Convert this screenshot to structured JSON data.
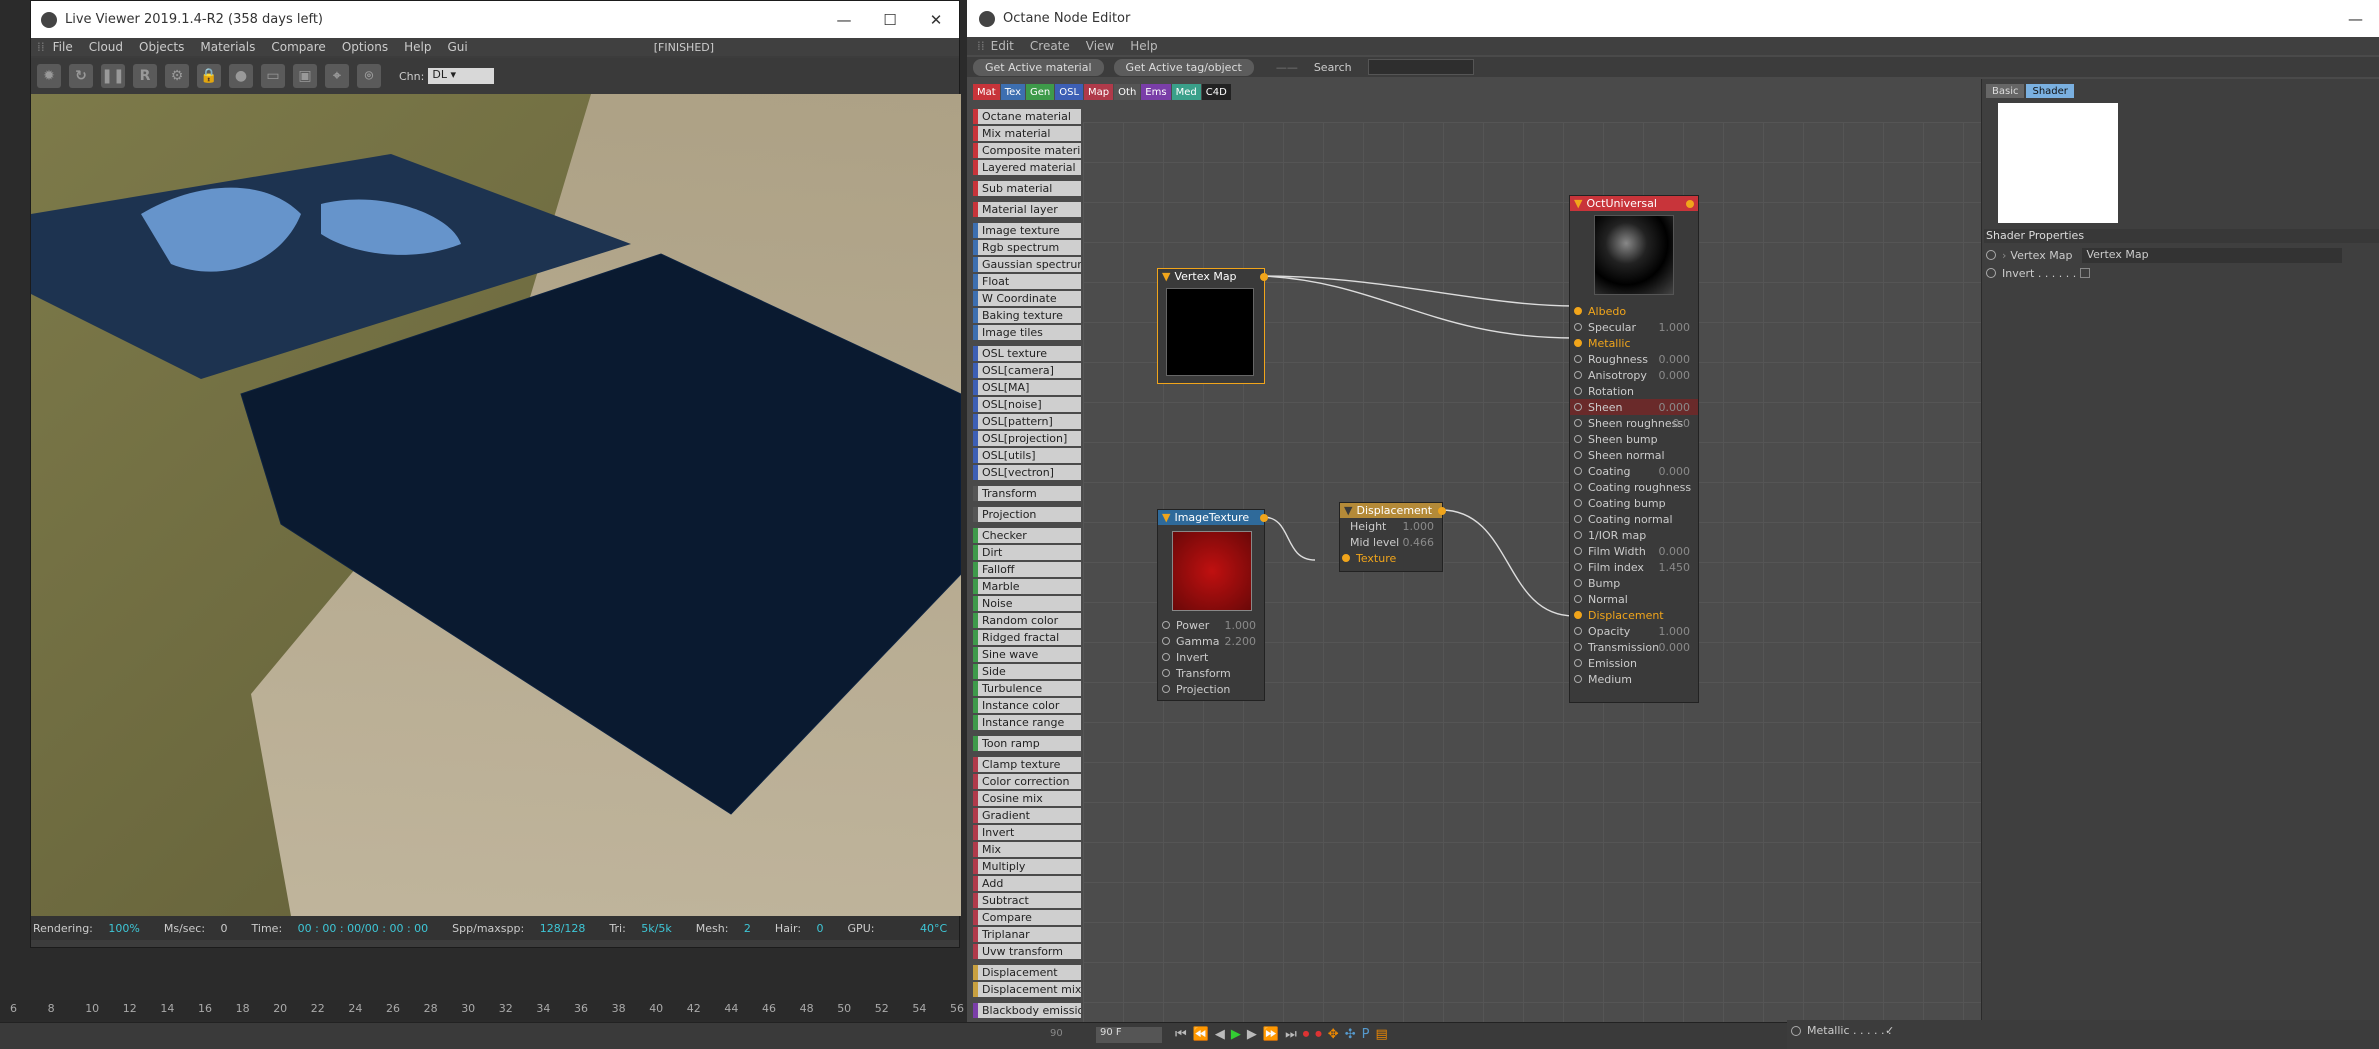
{
  "live_viewer": {
    "title": "Live Viewer 2019.1.4-R2 (358 days left)",
    "menu": [
      "File",
      "Cloud",
      "Objects",
      "Materials",
      "Compare",
      "Options",
      "Help",
      "Gui"
    ],
    "state": "[FINISHED]",
    "tool_icons": [
      "gear-icon",
      "refresh-icon",
      "pause-icon",
      "r-icon",
      "settings-icon",
      "lock-icon",
      "sphere-icon",
      "region-icon",
      "region2-icon",
      "pin-icon",
      "pin2-icon"
    ],
    "channel_label": "Chn:",
    "channel_value": "DL",
    "status": {
      "rendering_label": "Rendering:",
      "rendering": "100%",
      "ms_label": "Ms/sec:",
      "ms": "0",
      "time_label": "Time:",
      "time": "00 : 00 : 00/00 : 00 : 00",
      "spp_label": "Spp/maxspp:",
      "spp": "128/128",
      "tri_label": "Tri:",
      "tri": "5k/5k",
      "mesh_label": "Mesh:",
      "mesh": "2",
      "hair_label": "Hair:",
      "hair": "0",
      "gpu_label": "GPU:",
      "gpu": "40°C"
    }
  },
  "node_editor": {
    "title": "Octane Node Editor",
    "menu": [
      "Edit",
      "Create",
      "View",
      "Help"
    ],
    "get_active_material": "Get Active material",
    "get_active_tag": "Get Active tag/object",
    "search_label": "Search",
    "categories": [
      {
        "label": "Mat",
        "color": "#c8343a"
      },
      {
        "label": "Tex",
        "color": "#3d6fb0"
      },
      {
        "label": "Gen",
        "color": "#3e9a4a"
      },
      {
        "label": "OSL",
        "color": "#3d5fb5"
      },
      {
        "label": "Map",
        "color": "#b03a4a"
      },
      {
        "label": "Oth",
        "color": "#555"
      },
      {
        "label": "Ems",
        "color": "#7a3ea8"
      },
      {
        "label": "Med",
        "color": "#3aa08a"
      },
      {
        "label": "C4D",
        "color": "#222"
      }
    ],
    "node_list": [
      {
        "label": "Octane material",
        "color": "#c8343a"
      },
      {
        "label": "Mix material",
        "color": "#c8343a"
      },
      {
        "label": "Composite material",
        "color": "#c8343a"
      },
      {
        "label": "Layered material",
        "color": "#c8343a"
      },
      {
        "label": "Sub material",
        "color": "#c8343a",
        "gap": true
      },
      {
        "label": "Material layer",
        "color": "#c8343a",
        "gap": true
      },
      {
        "label": "Image texture",
        "color": "#3d6fb0",
        "gap": true
      },
      {
        "label": "Rgb spectrum",
        "color": "#3d6fb0"
      },
      {
        "label": "Gaussian spectrum",
        "color": "#3d6fb0"
      },
      {
        "label": "Float",
        "color": "#3d6fb0"
      },
      {
        "label": "W Coordinate",
        "color": "#3d6fb0"
      },
      {
        "label": "Baking texture",
        "color": "#3d6fb0"
      },
      {
        "label": "Image tiles",
        "color": "#3d6fb0"
      },
      {
        "label": "OSL texture",
        "color": "#3d5fb5",
        "gap": true
      },
      {
        "label": "OSL[camera]",
        "color": "#3d5fb5"
      },
      {
        "label": "OSL[MA]",
        "color": "#3d5fb5"
      },
      {
        "label": "OSL[noise]",
        "color": "#3d5fb5"
      },
      {
        "label": "OSL[pattern]",
        "color": "#3d5fb5"
      },
      {
        "label": "OSL[projection]",
        "color": "#3d5fb5"
      },
      {
        "label": "OSL[utils]",
        "color": "#3d5fb5"
      },
      {
        "label": "OSL[vectron]",
        "color": "#3d5fb5"
      },
      {
        "label": "Transform",
        "color": "#555",
        "gap": true
      },
      {
        "label": "Projection",
        "color": "#555",
        "gap": true
      },
      {
        "label": "Checker",
        "color": "#3e9a4a",
        "gap": true
      },
      {
        "label": "Dirt",
        "color": "#3e9a4a"
      },
      {
        "label": "Falloff",
        "color": "#3e9a4a"
      },
      {
        "label": "Marble",
        "color": "#3e9a4a"
      },
      {
        "label": "Noise",
        "color": "#3e9a4a"
      },
      {
        "label": "Random color",
        "color": "#3e9a4a"
      },
      {
        "label": "Ridged fractal",
        "color": "#3e9a4a"
      },
      {
        "label": "Sine wave",
        "color": "#3e9a4a"
      },
      {
        "label": "Side",
        "color": "#3e9a4a"
      },
      {
        "label": "Turbulence",
        "color": "#3e9a4a"
      },
      {
        "label": "Instance color",
        "color": "#3e9a4a"
      },
      {
        "label": "Instance range",
        "color": "#3e9a4a"
      },
      {
        "label": "Toon ramp",
        "color": "#3e9a4a",
        "gap": true
      },
      {
        "label": "Clamp texture",
        "color": "#b03a4a",
        "gap": true
      },
      {
        "label": "Color correction",
        "color": "#b03a4a"
      },
      {
        "label": "Cosine mix",
        "color": "#b03a4a"
      },
      {
        "label": "Gradient",
        "color": "#b03a4a"
      },
      {
        "label": "Invert",
        "color": "#b03a4a"
      },
      {
        "label": "Mix",
        "color": "#b03a4a"
      },
      {
        "label": "Multiply",
        "color": "#b03a4a"
      },
      {
        "label": "Add",
        "color": "#b03a4a"
      },
      {
        "label": "Subtract",
        "color": "#b03a4a"
      },
      {
        "label": "Compare",
        "color": "#b03a4a"
      },
      {
        "label": "Triplanar",
        "color": "#b03a4a"
      },
      {
        "label": "Uvw transform",
        "color": "#b03a4a"
      },
      {
        "label": "Displacement",
        "color": "#c8a040",
        "gap": true
      },
      {
        "label": "Displacement mixer",
        "color": "#c8a040"
      },
      {
        "label": "Blackbody emission",
        "color": "#7a3ea8",
        "gap": true
      }
    ],
    "vertex_map_node": {
      "title": "Vertex Map"
    },
    "image_texture_node": {
      "title": "ImageTexture",
      "params": [
        {
          "label": "Power",
          "value": "1.000"
        },
        {
          "label": "Gamma",
          "value": "2.200"
        },
        {
          "label": "Invert",
          "value": ""
        },
        {
          "label": "Transform",
          "value": ""
        },
        {
          "label": "Projection",
          "value": ""
        }
      ]
    },
    "displacement_node": {
      "title": "Displacement",
      "params": [
        {
          "label": "Height",
          "value": "1.000"
        },
        {
          "label": "Mid level",
          "value": "0.466"
        },
        {
          "label": "Texture",
          "value": ""
        }
      ]
    },
    "universal_node": {
      "title": "OctUniversal",
      "params": [
        {
          "label": "Albedo",
          "value": "",
          "on": true
        },
        {
          "label": "Specular",
          "value": "1.000"
        },
        {
          "label": "Metallic",
          "value": "",
          "on": true
        },
        {
          "label": "Roughness",
          "value": "0.000"
        },
        {
          "label": "Anisotropy",
          "value": "0.000"
        },
        {
          "label": "Rotation",
          "value": ""
        },
        {
          "label": "Sheen",
          "value": "0.000"
        },
        {
          "label": "Sheen roughness",
          "value": "0.0"
        },
        {
          "label": "Sheen bump",
          "value": ""
        },
        {
          "label": "Sheen normal",
          "value": ""
        },
        {
          "label": "Coating",
          "value": "0.000"
        },
        {
          "label": "Coating roughness",
          "value": ""
        },
        {
          "label": "Coating bump",
          "value": ""
        },
        {
          "label": "Coating normal",
          "value": ""
        },
        {
          "label": "1/IOR map",
          "value": ""
        },
        {
          "label": "Film Width",
          "value": "0.000"
        },
        {
          "label": "Film index",
          "value": "1.450"
        },
        {
          "label": "Bump",
          "value": ""
        },
        {
          "label": "Normal",
          "value": ""
        },
        {
          "label": "Displacement",
          "value": "",
          "on": true
        },
        {
          "label": "Opacity",
          "value": "1.000"
        },
        {
          "label": "Transmission",
          "value": "0.000"
        },
        {
          "label": "Emission",
          "value": ""
        },
        {
          "label": "Medium",
          "value": ""
        }
      ]
    },
    "right_panel": {
      "tab_basic": "Basic",
      "tab_shader": "Shader",
      "shader_properties": "Shader Properties",
      "vertex_map_label": "Vertex Map",
      "vertex_map_value": "Vertex Map",
      "invert_label": "Invert . . . . . ."
    }
  },
  "timeline": {
    "ticks": [
      "6",
      "8",
      "10",
      "12",
      "14",
      "16",
      "18",
      "20",
      "22",
      "24",
      "26",
      "28",
      "30",
      "32",
      "34",
      "36",
      "38",
      "40",
      "42",
      "44",
      "46",
      "48",
      "50",
      "52",
      "54",
      "56"
    ],
    "frame_a": "90",
    "frame_b": "90 F",
    "attr_label": "Metallic . . . . . ."
  }
}
